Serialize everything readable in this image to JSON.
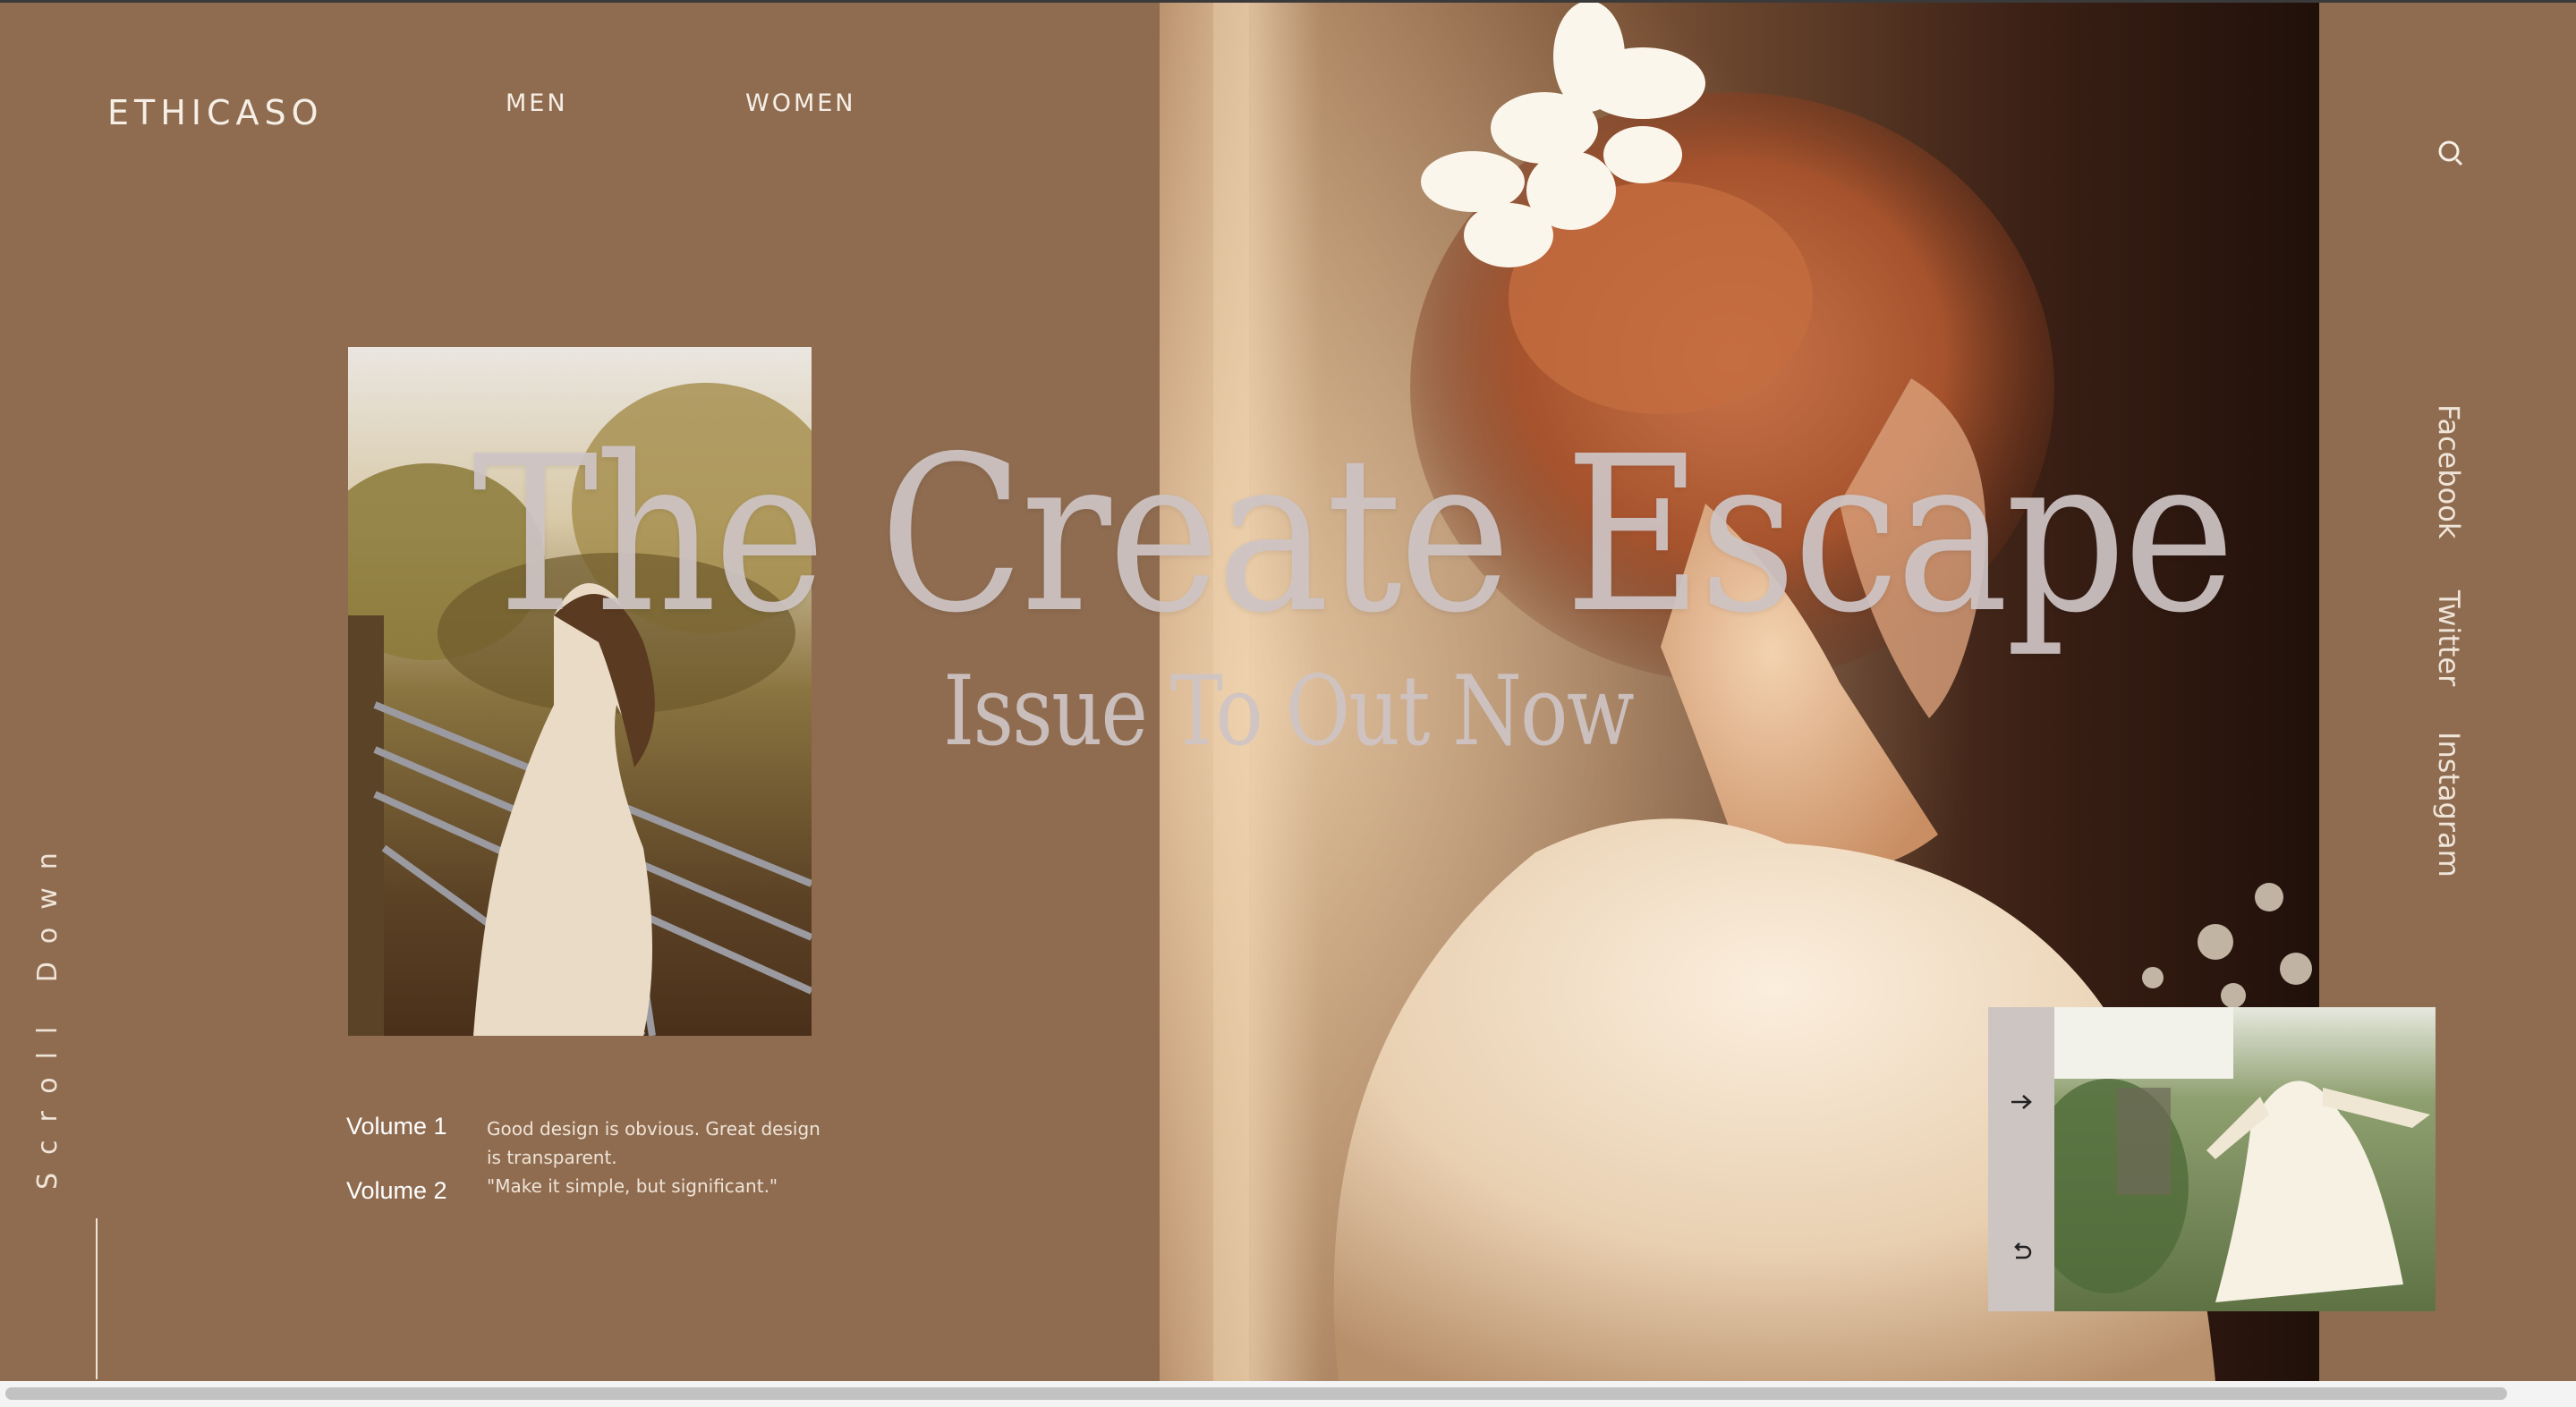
{
  "header": {
    "logo": "ETHICASO",
    "nav": [
      {
        "label": "MEN"
      },
      {
        "label": "WOMEN"
      }
    ]
  },
  "hero": {
    "title": "The Create Escape",
    "subtitle": "Issue To Out Now"
  },
  "volumes": [
    {
      "label": "Volume 1"
    },
    {
      "label": "Volume 2"
    }
  ],
  "description": {
    "line1": "Good design is obvious. Great design",
    "line2": "is transparent.",
    "line3": "\"Make it simple, but significant.\""
  },
  "scroll": {
    "label": "Scroll Down"
  },
  "social": [
    {
      "label": "Facebook"
    },
    {
      "label": "Twitter"
    },
    {
      "label": "Instagram"
    }
  ],
  "icons": {
    "search": "search-icon",
    "next": "arrow-right-icon",
    "replay": "replay-icon"
  },
  "colors": {
    "background": "#8f6c50",
    "text_light": "#f6efe6",
    "headline": "#cec4c4"
  }
}
